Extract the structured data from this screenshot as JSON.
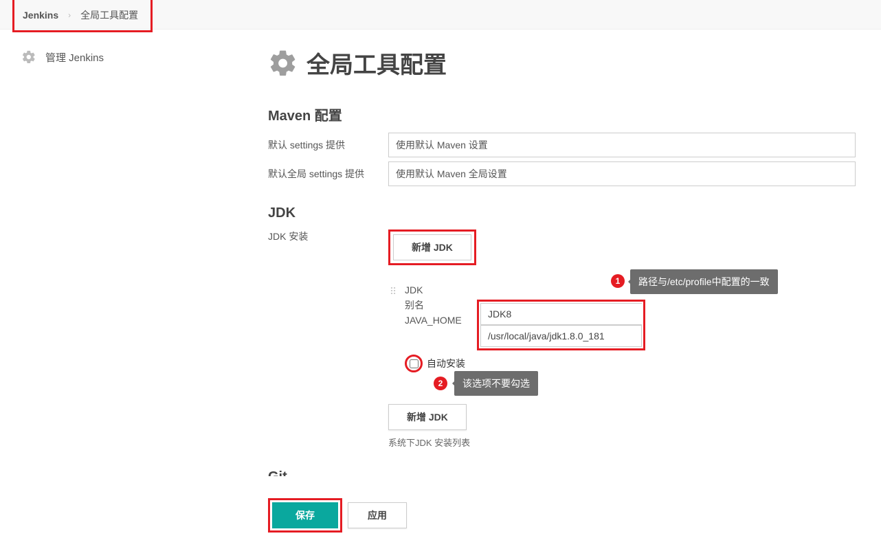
{
  "breadcrumb": {
    "root": "Jenkins",
    "current": "全局工具配置"
  },
  "sidebar": {
    "manage_label": "管理 Jenkins"
  },
  "page": {
    "title": "全局工具配置"
  },
  "maven": {
    "section_title": "Maven 配置",
    "default_settings_label": "默认 settings 提供",
    "default_settings_value": "使用默认 Maven 设置",
    "default_global_settings_label": "默认全局 settings 提供",
    "default_global_settings_value": "使用默认 Maven 全局设置"
  },
  "jdk": {
    "section_title": "JDK",
    "install_label": "JDK 安装",
    "add_button": "新增 JDK",
    "name_label": "JDK",
    "alias_label": "别名",
    "name_value": "JDK8",
    "home_label": "JAVA_HOME",
    "home_value": "/usr/local/java/jdk1.8.0_181",
    "auto_install_label": "自动安装",
    "add_button2": "新增 JDK",
    "helper_text": "系统下JDK 安装列表",
    "callout1_num": "1",
    "callout1_text": "路径与/etc/profile中配置的一致",
    "callout2_num": "2",
    "callout2_text": "该选项不要勾选"
  },
  "git": {
    "cutoff": "Git"
  },
  "footer": {
    "save": "保存",
    "apply": "应用"
  }
}
